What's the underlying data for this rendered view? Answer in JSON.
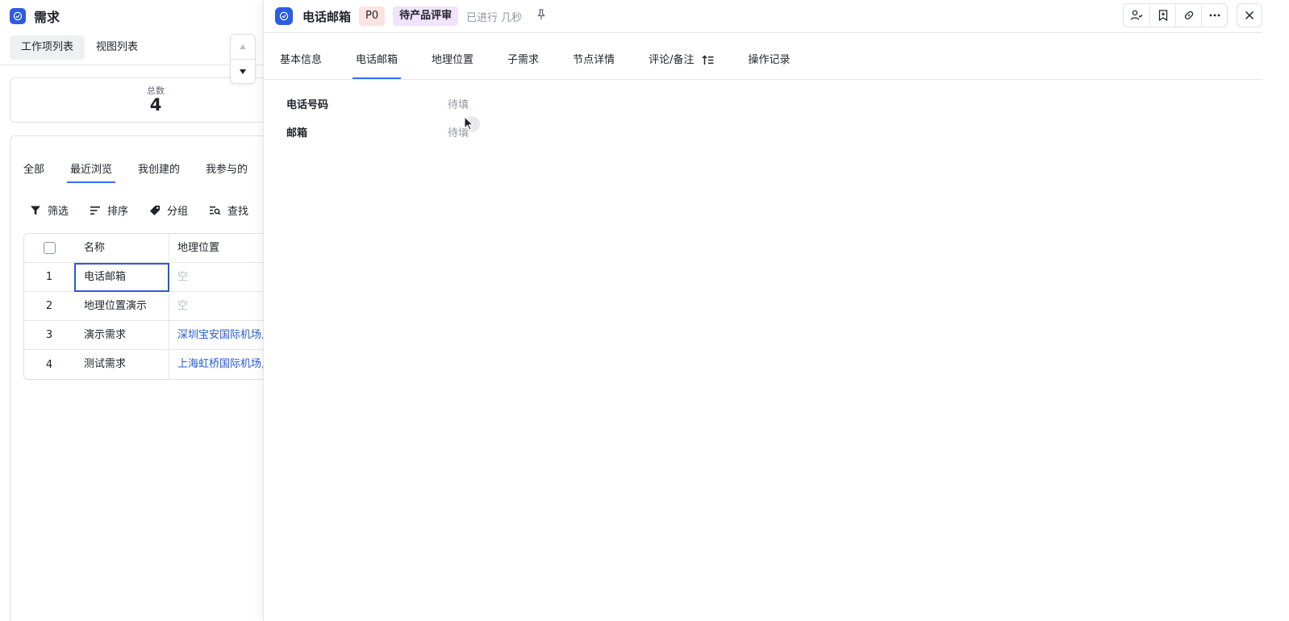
{
  "app": {
    "title": "需求"
  },
  "view_tabs": [
    {
      "label": "工作项列表",
      "active": true
    },
    {
      "label": "视图列表",
      "active": false
    }
  ],
  "summary": {
    "label": "总数",
    "value": "4"
  },
  "filter_tabs": [
    {
      "label": "全部",
      "active": false
    },
    {
      "label": "最近浏览",
      "active": true
    },
    {
      "label": "我创建的",
      "active": false
    },
    {
      "label": "我参与的",
      "active": false
    }
  ],
  "toolbar": {
    "filter_label": "筛选",
    "sort_label": "排序",
    "group_label": "分组",
    "find_label": "查找"
  },
  "table": {
    "columns": [
      "名称",
      "地理位置"
    ],
    "rows": [
      {
        "index": "1",
        "name": "电话邮箱",
        "location": "空",
        "location_empty": true
      },
      {
        "index": "2",
        "name": "地理位置演示",
        "location": "空",
        "location_empty": true
      },
      {
        "index": "3",
        "name": "演示需求",
        "location": "深圳宝安国际机场,",
        "location_empty": false
      },
      {
        "index": "4",
        "name": "测试需求",
        "location": "上海虹桥国际机场,",
        "location_empty": false
      }
    ]
  },
  "detail": {
    "title": "电话邮箱",
    "priority": "P0",
    "status": "待产品评审",
    "elapsed": "已进行 几秒",
    "tabs": [
      {
        "label": "基本信息",
        "active": false
      },
      {
        "label": "电话邮箱",
        "active": true
      },
      {
        "label": "地理位置",
        "active": false
      },
      {
        "label": "子需求",
        "active": false
      },
      {
        "label": "节点详情",
        "active": false
      },
      {
        "label": "评论/备注",
        "active": false
      },
      {
        "label": "操作记录",
        "active": false
      }
    ],
    "fields": [
      {
        "label": "电话号码",
        "value": "待填"
      },
      {
        "label": "邮箱",
        "value": "待填"
      }
    ]
  },
  "colors": {
    "accent": "#3370ff",
    "brand_icon": "#2c5ce0",
    "priority_bg": "#fde2e2",
    "status_bg": "#f1e3fb",
    "link": "#245bdb"
  }
}
